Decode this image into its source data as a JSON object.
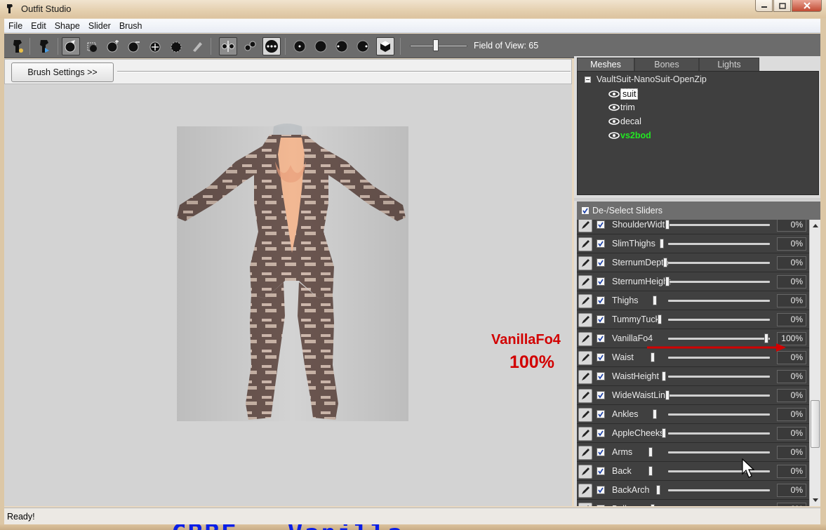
{
  "window": {
    "title": "Outfit Studio"
  },
  "menu": [
    "File",
    "Edit",
    "Shape",
    "Slider",
    "Brush"
  ],
  "toolbar": {
    "fov_label": "Field of View: 65",
    "fov_value": 65
  },
  "brush_settings_label": "Brush Settings >>",
  "viewport": {
    "caption": "CBBE → Vanilla",
    "annotation_name": "VanillaFo4",
    "annotation_value": "100%"
  },
  "tabs": [
    {
      "label": "Meshes",
      "active": true
    },
    {
      "label": "Bones",
      "active": false
    },
    {
      "label": "Lights",
      "active": false
    }
  ],
  "tree": {
    "root": "VaultSuit-NanoSuit-OpenZip",
    "items": [
      {
        "label": "suit",
        "selected": true,
        "color": "#ffffff"
      },
      {
        "label": "trim",
        "selected": false,
        "color": "#f0f0f0"
      },
      {
        "label": "decal",
        "selected": false,
        "color": "#f0f0f0"
      },
      {
        "label": "vs2bod",
        "selected": false,
        "color": "#22e622"
      }
    ]
  },
  "sliders_header": "De-/Select Sliders",
  "sliders": [
    {
      "name": "ShoulderWidth",
      "value": "0%",
      "level": 0
    },
    {
      "name": "SlimThighs",
      "value": "0%",
      "level": 0
    },
    {
      "name": "SternumDepth",
      "value": "0%",
      "level": 0
    },
    {
      "name": "SternumHeight",
      "value": "0%",
      "level": 0
    },
    {
      "name": "Thighs",
      "value": "0%",
      "level": 0
    },
    {
      "name": "TummyTuck",
      "value": "0%",
      "level": 0
    },
    {
      "name": "VanillaFo4",
      "value": "100%",
      "level": 1
    },
    {
      "name": "Waist",
      "value": "0%",
      "level": 0
    },
    {
      "name": "WaistHeight",
      "value": "0%",
      "level": 0
    },
    {
      "name": "WideWaistLine",
      "value": "0%",
      "level": 0
    },
    {
      "name": "Ankles",
      "value": "0%",
      "level": 0
    },
    {
      "name": "AppleCheeks",
      "value": "0%",
      "level": 0
    },
    {
      "name": "Arms",
      "value": "0%",
      "level": 0
    },
    {
      "name": "Back",
      "value": "0%",
      "level": 0
    },
    {
      "name": "BackArch",
      "value": "0%",
      "level": 0
    },
    {
      "name": "Belly",
      "value": "0%",
      "level": 0
    }
  ],
  "status": "Ready!",
  "colors": {
    "annotation": "#d20000",
    "caption": "#0a1ee6",
    "panel": "#3f3f3f"
  }
}
